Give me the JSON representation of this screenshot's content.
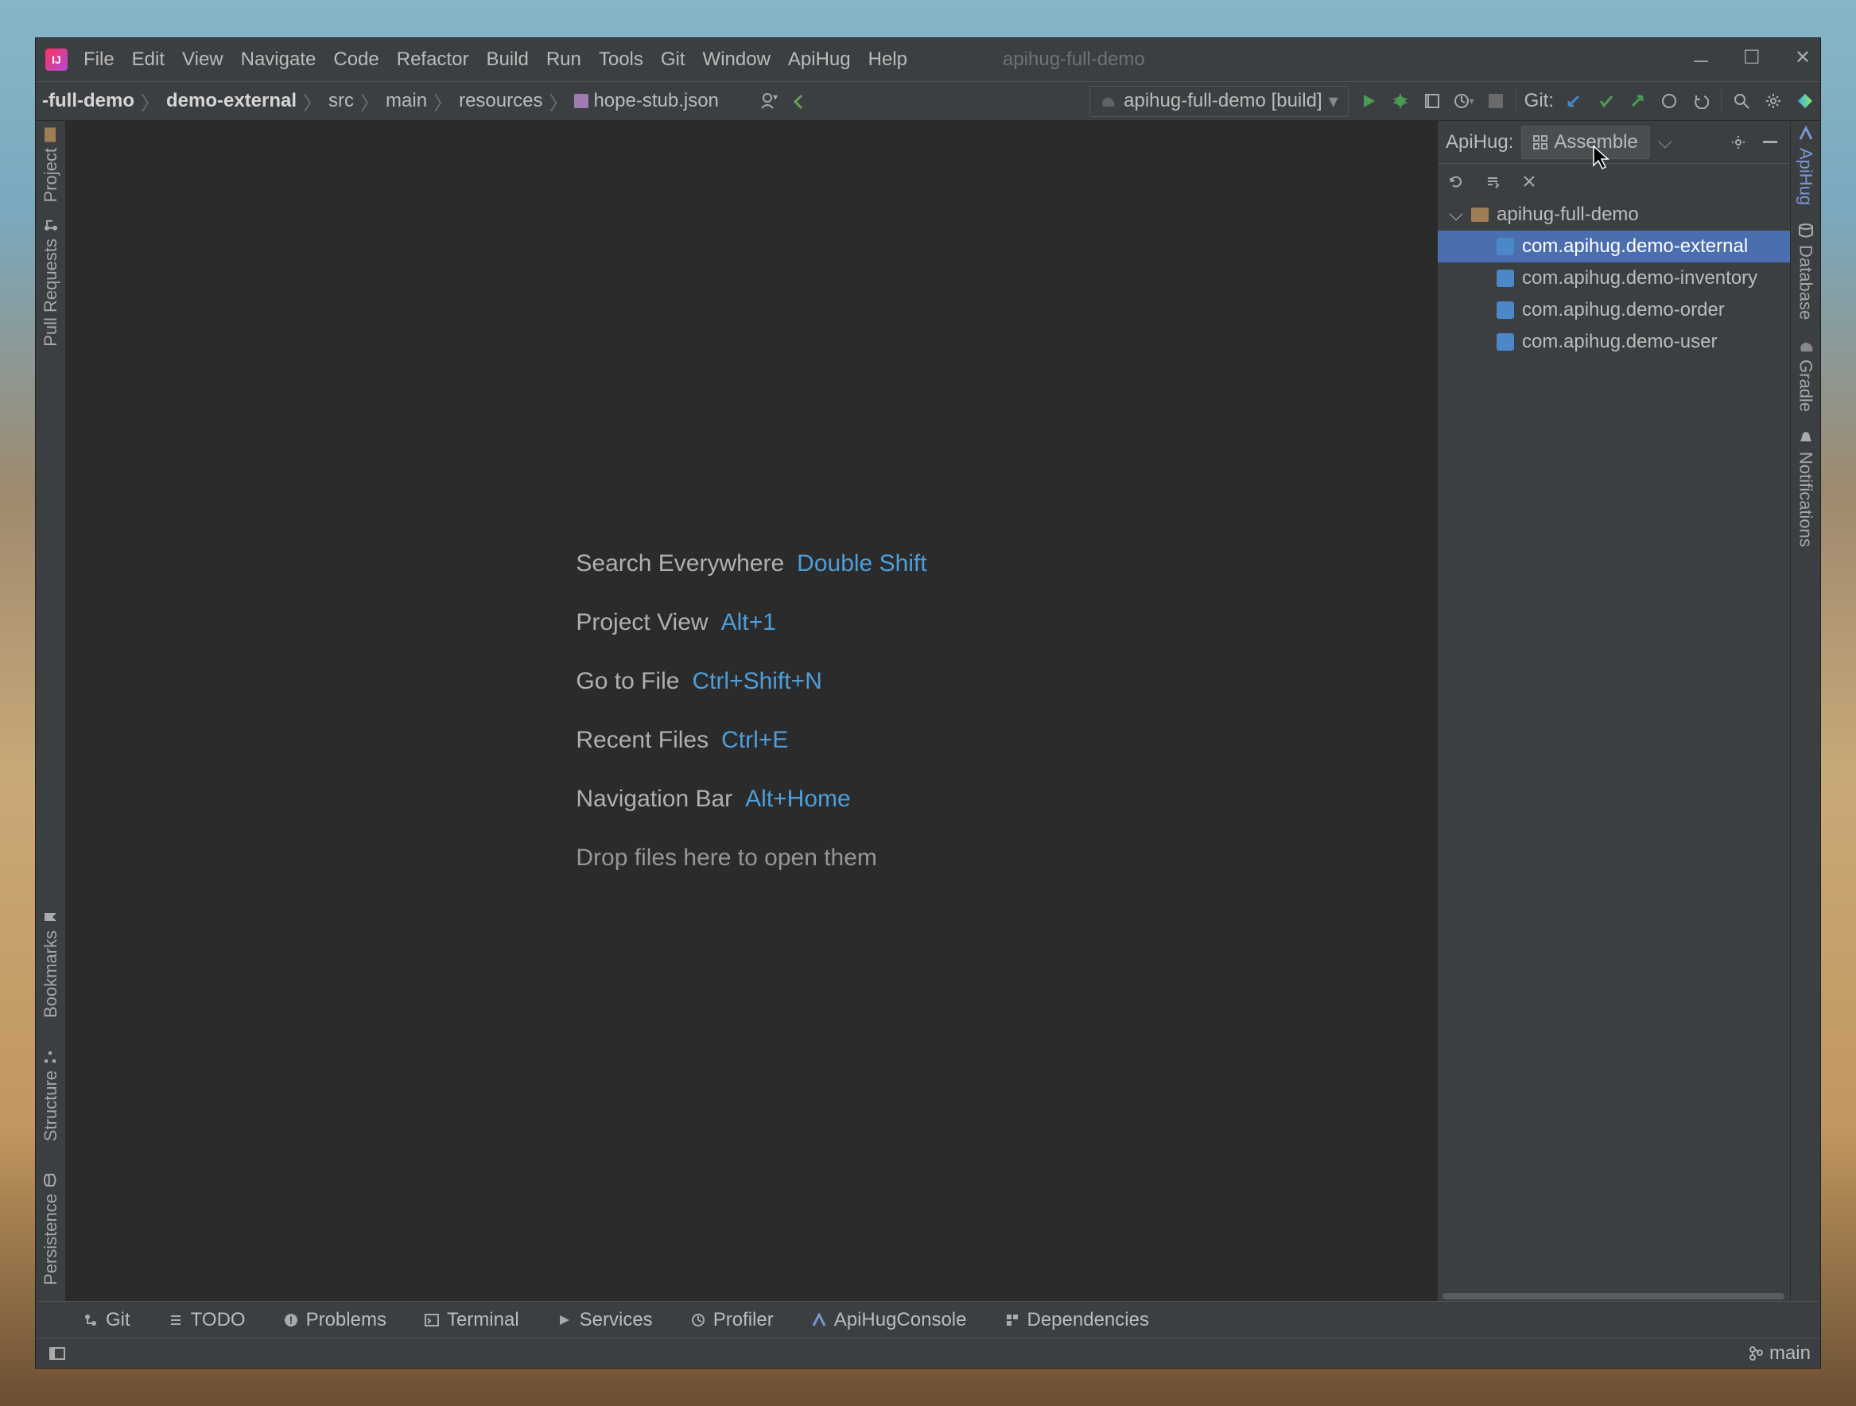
{
  "window": {
    "title": "apihug-full-demo"
  },
  "menu": {
    "items": [
      "File",
      "Edit",
      "View",
      "Navigate",
      "Code",
      "Refactor",
      "Build",
      "Run",
      "Tools",
      "Git",
      "Window",
      "ApiHug",
      "Help"
    ]
  },
  "breadcrumb": {
    "items": [
      "-full-demo",
      "demo-external",
      "src",
      "main",
      "resources",
      "hope-stub.json"
    ]
  },
  "toolbar": {
    "run_config": "apihug-full-demo [build]",
    "git_label": "Git:"
  },
  "welcome": {
    "rows": [
      {
        "label": "Search Everywhere",
        "key": "Double Shift"
      },
      {
        "label": "Project View",
        "key": "Alt+1"
      },
      {
        "label": "Go to File",
        "key": "Ctrl+Shift+N"
      },
      {
        "label": "Recent Files",
        "key": "Ctrl+E"
      },
      {
        "label": "Navigation Bar",
        "key": "Alt+Home"
      }
    ],
    "drop": "Drop files here to open them"
  },
  "left_rail": [
    "Project",
    "Pull Requests",
    "Bookmarks",
    "Structure",
    "Persistence"
  ],
  "right_rail": [
    "ApiHug",
    "Database",
    "Gradle",
    "Notifications"
  ],
  "apihug_panel": {
    "title": "ApiHug:",
    "view_label": "Assemble",
    "root": "apihug-full-demo",
    "modules": [
      "com.apihug.demo-external",
      "com.apihug.demo-inventory",
      "com.apihug.demo-order",
      "com.apihug.demo-user"
    ],
    "selected_index": 0
  },
  "bottom_tools": [
    "Git",
    "TODO",
    "Problems",
    "Terminal",
    "Services",
    "Profiler",
    "ApiHugConsole",
    "Dependencies"
  ],
  "status": {
    "branch": "main"
  }
}
